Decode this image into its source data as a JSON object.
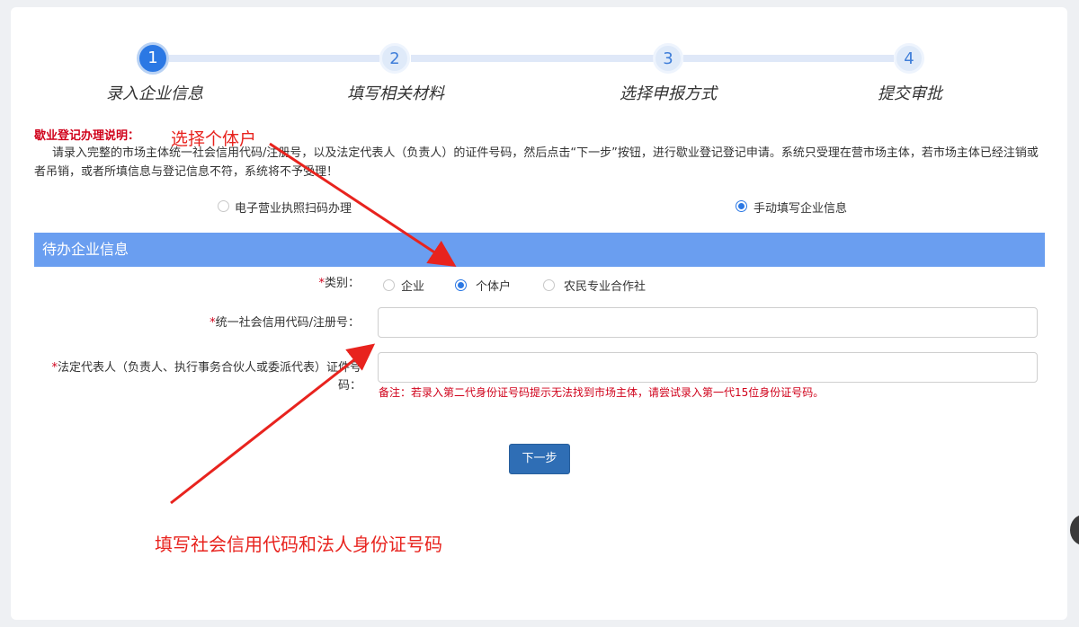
{
  "steps": [
    {
      "num": "1",
      "label": "录入企业信息"
    },
    {
      "num": "2",
      "label": "填写相关材料"
    },
    {
      "num": "3",
      "label": "选择申报方式"
    },
    {
      "num": "4",
      "label": "提交审批"
    }
  ],
  "notice": {
    "title": "歇业登记办理说明：",
    "body": "请录入完整的市场主体统一社会信用代码/注册号，以及法定代表人（负责人）的证件号码，然后点击“下一步”按钮，进行歇业登记登记申请。系统只受理在营市场主体，若市场主体已经注销或者吊销，或者所填信息与登记信息不符，系统将不予受理！"
  },
  "annotations": {
    "select_individual": "选择个体户",
    "fill_codes": "填写社会信用代码和法人身份证号码"
  },
  "mode_options": [
    {
      "label": "电子营业执照扫码办理",
      "checked": false
    },
    {
      "label": "手动填写企业信息",
      "checked": true
    }
  ],
  "section_title": "待办企业信息",
  "form": {
    "category_label": "类别：",
    "category_options": [
      {
        "label": "企业",
        "checked": false
      },
      {
        "label": "个体户",
        "checked": true
      },
      {
        "label": "农民专业合作社",
        "checked": false
      }
    ],
    "credit_code_label": "统一社会信用代码/注册号：",
    "credit_code_value": "",
    "legal_rep_label": "法定代表人（负责人、执行事务合伙人或委派代表）证件号码：",
    "legal_rep_value": "",
    "required_mark": "*",
    "note": "备注：若录入第二代身份证号码提示无法找到市场主体，请尝试录入第一代15位身份证号码。",
    "next_button": "下一步"
  },
  "colors": {
    "primary": "#2b78e4",
    "section_bar": "#6a9ef0",
    "annotation": "#e8231e",
    "required": "#d0021b",
    "button": "#2f6eb5"
  }
}
